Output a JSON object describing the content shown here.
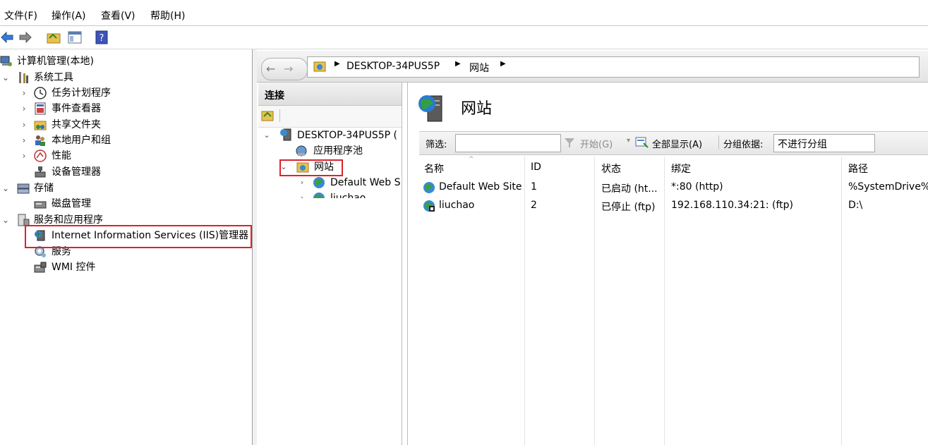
{
  "menu": [
    "文件(F)",
    "操作(A)",
    "查看(V)",
    "帮助(H)"
  ],
  "tree": {
    "root": "计算机管理(本地)",
    "system_tools": "系统工具",
    "task_scheduler": "任务计划程序",
    "event_viewer": "事件查看器",
    "shared_folders": "共享文件夹",
    "local_users": "本地用户和组",
    "performance": "性能",
    "device_manager": "设备管理器",
    "storage": "存储",
    "disk_management": "磁盘管理",
    "services_apps": "服务和应用程序",
    "iis_manager": "Internet Information Services (IIS)管理器",
    "services": "服务",
    "wmi": "WMI 控件"
  },
  "address": {
    "server": "DESKTOP-34PUS5P",
    "site": "网站"
  },
  "connections": {
    "title": "连接",
    "server": "DESKTOP-34PUS5P (",
    "app_pools": "应用程序池",
    "sites": "网站",
    "site1": "Default Web S",
    "site2": "liuchao"
  },
  "main": {
    "title": "网站",
    "filter_label": "筛选:",
    "start_label": "开始(G)",
    "show_all_label": "全部显示(A)",
    "group_by_label": "分组依据:",
    "group_by_value": "不进行分组",
    "columns": [
      "名称",
      "ID",
      "状态",
      "绑定",
      "路径"
    ],
    "rows": [
      {
        "name": "Default Web Site",
        "id": "1",
        "status": "已启动 (ht...",
        "binding": "*:80 (http)",
        "path": "%SystemDrive%\\"
      },
      {
        "name": "liuchao",
        "id": "2",
        "status": "已停止 (ftp)",
        "binding": "192.168.110.34:21: (ftp)",
        "path": "D:\\"
      }
    ]
  },
  "colors": {
    "highlight_box": "#d9232e"
  }
}
